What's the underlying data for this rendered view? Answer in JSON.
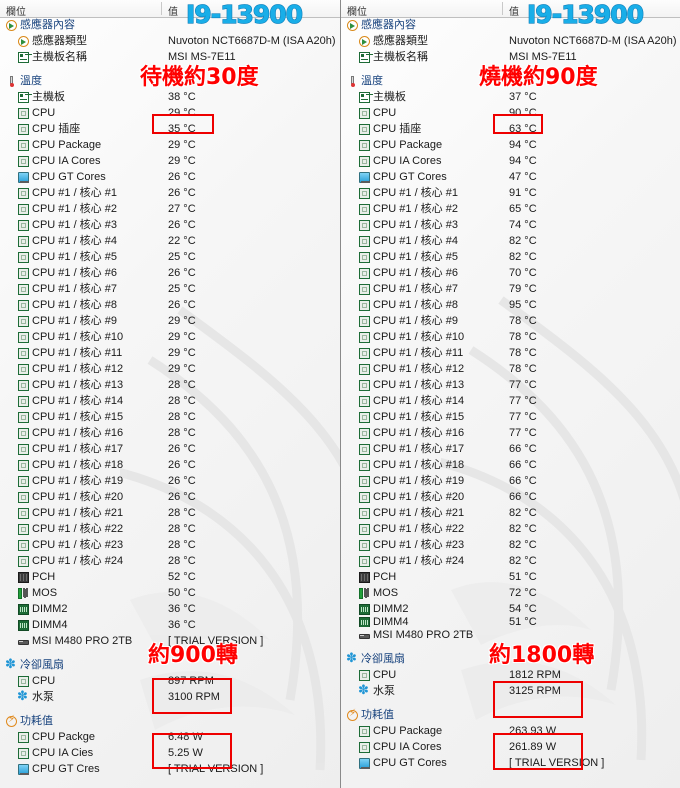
{
  "app": {
    "name": "HWiNFO64 Sensor Status",
    "columns": {
      "field": "欄位",
      "value": "值"
    }
  },
  "annotations": {
    "cpu_model": "I9-13900",
    "left_temp_note": "待機約30度",
    "right_temp_note": "燒機約90度",
    "left_fan_note": "約900轉",
    "right_fan_note": "約1800轉",
    "colors": {
      "red": "#ff0000",
      "blue": "#19aee8",
      "box": "#ee0000"
    }
  },
  "panels": [
    {
      "id": "idle",
      "sections": [
        {
          "name": "感應器內容",
          "icon": "sensor-icon",
          "rows": [
            {
              "label": "感應器類型",
              "value": "Nuvoton NCT6687D-M  (ISA A20h)",
              "icon": "sensor-icon",
              "indent": 2
            },
            {
              "label": "主機板名稱",
              "value": "MSI MS-7E11",
              "icon": "motherboard-icon",
              "indent": 2
            }
          ]
        },
        {
          "name": "溫度",
          "icon": "thermometer-icon",
          "rows": [
            {
              "label": "主機板",
              "value": "38 °C",
              "icon": "motherboard-icon",
              "indent": 2
            },
            {
              "label": "CPU",
              "value": "29 °C",
              "icon": "cpu-icon",
              "indent": 2
            },
            {
              "label": "CPU 插座",
              "value": "35 °C",
              "icon": "cpu-icon",
              "indent": 2
            },
            {
              "label": "CPU Package",
              "value": "29 °C",
              "icon": "cpu-icon",
              "indent": 2
            },
            {
              "label": "CPU IA Cores",
              "value": "29 °C",
              "icon": "cpu-icon",
              "indent": 2
            },
            {
              "label": "CPU GT Cores",
              "value": "26 °C",
              "icon": "gpu-icon",
              "indent": 2
            },
            {
              "label": "CPU #1 / 核心 #1",
              "value": "26 °C",
              "icon": "cpu-icon",
              "indent": 2
            },
            {
              "label": "CPU #1 / 核心 #2",
              "value": "27 °C",
              "icon": "cpu-icon",
              "indent": 2
            },
            {
              "label": "CPU #1 / 核心 #3",
              "value": "26 °C",
              "icon": "cpu-icon",
              "indent": 2
            },
            {
              "label": "CPU #1 / 核心 #4",
              "value": "22 °C",
              "icon": "cpu-icon",
              "indent": 2
            },
            {
              "label": "CPU #1 / 核心 #5",
              "value": "25 °C",
              "icon": "cpu-icon",
              "indent": 2
            },
            {
              "label": "CPU #1 / 核心 #6",
              "value": "26 °C",
              "icon": "cpu-icon",
              "indent": 2
            },
            {
              "label": "CPU #1 / 核心 #7",
              "value": "25 °C",
              "icon": "cpu-icon",
              "indent": 2
            },
            {
              "label": "CPU #1 / 核心 #8",
              "value": "26 °C",
              "icon": "cpu-icon",
              "indent": 2
            },
            {
              "label": "CPU #1 / 核心 #9",
              "value": "29 °C",
              "icon": "cpu-icon",
              "indent": 2
            },
            {
              "label": "CPU #1 / 核心 #10",
              "value": "29 °C",
              "icon": "cpu-icon",
              "indent": 2
            },
            {
              "label": "CPU #1 / 核心 #11",
              "value": "29 °C",
              "icon": "cpu-icon",
              "indent": 2
            },
            {
              "label": "CPU #1 / 核心 #12",
              "value": "29 °C",
              "icon": "cpu-icon",
              "indent": 2
            },
            {
              "label": "CPU #1 / 核心 #13",
              "value": "28 °C",
              "icon": "cpu-icon",
              "indent": 2
            },
            {
              "label": "CPU #1 / 核心 #14",
              "value": "28 °C",
              "icon": "cpu-icon",
              "indent": 2
            },
            {
              "label": "CPU #1 / 核心 #15",
              "value": "28 °C",
              "icon": "cpu-icon",
              "indent": 2
            },
            {
              "label": "CPU #1 / 核心 #16",
              "value": "28 °C",
              "icon": "cpu-icon",
              "indent": 2
            },
            {
              "label": "CPU #1 / 核心 #17",
              "value": "26 °C",
              "icon": "cpu-icon",
              "indent": 2
            },
            {
              "label": "CPU #1 / 核心 #18",
              "value": "26 °C",
              "icon": "cpu-icon",
              "indent": 2
            },
            {
              "label": "CPU #1 / 核心 #19",
              "value": "26 °C",
              "icon": "cpu-icon",
              "indent": 2
            },
            {
              "label": "CPU #1 / 核心 #20",
              "value": "26 °C",
              "icon": "cpu-icon",
              "indent": 2
            },
            {
              "label": "CPU #1 / 核心 #21",
              "value": "28 °C",
              "icon": "cpu-icon",
              "indent": 2
            },
            {
              "label": "CPU #1 / 核心 #22",
              "value": "28 °C",
              "icon": "cpu-icon",
              "indent": 2
            },
            {
              "label": "CPU #1 / 核心 #23",
              "value": "28 °C",
              "icon": "cpu-icon",
              "indent": 2
            },
            {
              "label": "CPU #1 / 核心 #24",
              "value": "28 °C",
              "icon": "cpu-icon",
              "indent": 2
            },
            {
              "label": "PCH",
              "value": "52 °C",
              "icon": "chipset-icon",
              "indent": 2
            },
            {
              "label": "MOS",
              "value": "50 °C",
              "icon": "vrm-icon",
              "indent": 2
            },
            {
              "label": "DIMM2",
              "value": "36 °C",
              "icon": "memory-icon",
              "indent": 2
            },
            {
              "label": "DIMM4",
              "value": "36 °C",
              "icon": "memory-icon",
              "indent": 2
            },
            {
              "label": "MSI M480 PRO 2TB",
              "value": "[ TRIAL VERSION ]",
              "icon": "ssd-icon",
              "indent": 2
            }
          ]
        },
        {
          "name": "冷卻風扇",
          "icon": "fan-icon",
          "rows": [
            {
              "label": "CPU",
              "value": "897 RPM",
              "icon": "cpu-icon",
              "indent": 2
            },
            {
              "label": "水泵",
              "value": "3100 RPM",
              "icon": "pump-icon",
              "indent": 2
            }
          ]
        },
        {
          "name": "功耗值",
          "icon": "power-icon",
          "rows": [
            {
              "label": "CPU Packge",
              "value": "6.48 W",
              "icon": "cpu-icon",
              "indent": 2
            },
            {
              "label": "CPU IA Cies",
              "value": "5.25 W",
              "icon": "cpu-icon",
              "indent": 2
            },
            {
              "label": "CPU GT Cres",
              "value": "[ TRIAL VERSION ]",
              "icon": "gpu-icon",
              "indent": 2
            }
          ]
        }
      ]
    },
    {
      "id": "load",
      "sections": [
        {
          "name": "感應器內容",
          "icon": "sensor-icon",
          "rows": [
            {
              "label": "感應器類型",
              "value": "Nuvoton NCT6687D-M  (ISA A20h)",
              "icon": "sensor-icon",
              "indent": 2
            },
            {
              "label": "主機板名稱",
              "value": "MSI MS-7E11",
              "icon": "motherboard-icon",
              "indent": 2
            }
          ]
        },
        {
          "name": "溫度",
          "icon": "thermometer-icon",
          "rows": [
            {
              "label": "主機板",
              "value": "37 °C",
              "icon": "motherboard-icon",
              "indent": 2
            },
            {
              "label": "CPU",
              "value": "90 °C",
              "icon": "cpu-icon",
              "indent": 2
            },
            {
              "label": "CPU 插座",
              "value": "63 °C",
              "icon": "cpu-icon",
              "indent": 2
            },
            {
              "label": "CPU Package",
              "value": "94 °C",
              "icon": "cpu-icon",
              "indent": 2
            },
            {
              "label": "CPU IA Cores",
              "value": "94 °C",
              "icon": "cpu-icon",
              "indent": 2
            },
            {
              "label": "CPU GT Cores",
              "value": "47 °C",
              "icon": "gpu-icon",
              "indent": 2
            },
            {
              "label": "CPU #1 / 核心 #1",
              "value": "91 °C",
              "icon": "cpu-icon",
              "indent": 2
            },
            {
              "label": "CPU #1 / 核心 #2",
              "value": "65 °C",
              "icon": "cpu-icon",
              "indent": 2
            },
            {
              "label": "CPU #1 / 核心 #3",
              "value": "74 °C",
              "icon": "cpu-icon",
              "indent": 2
            },
            {
              "label": "CPU #1 / 核心 #4",
              "value": "82 °C",
              "icon": "cpu-icon",
              "indent": 2
            },
            {
              "label": "CPU #1 / 核心 #5",
              "value": "82 °C",
              "icon": "cpu-icon",
              "indent": 2
            },
            {
              "label": "CPU #1 / 核心 #6",
              "value": "70 °C",
              "icon": "cpu-icon",
              "indent": 2
            },
            {
              "label": "CPU #1 / 核心 #7",
              "value": "79 °C",
              "icon": "cpu-icon",
              "indent": 2
            },
            {
              "label": "CPU #1 / 核心 #8",
              "value": "95 °C",
              "icon": "cpu-icon",
              "indent": 2
            },
            {
              "label": "CPU #1 / 核心 #9",
              "value": "78 °C",
              "icon": "cpu-icon",
              "indent": 2
            },
            {
              "label": "CPU #1 / 核心 #10",
              "value": "78 °C",
              "icon": "cpu-icon",
              "indent": 2
            },
            {
              "label": "CPU #1 / 核心 #11",
              "value": "78 °C",
              "icon": "cpu-icon",
              "indent": 2
            },
            {
              "label": "CPU #1 / 核心 #12",
              "value": "78 °C",
              "icon": "cpu-icon",
              "indent": 2
            },
            {
              "label": "CPU #1 / 核心 #13",
              "value": "77 °C",
              "icon": "cpu-icon",
              "indent": 2
            },
            {
              "label": "CPU #1 / 核心 #14",
              "value": "77 °C",
              "icon": "cpu-icon",
              "indent": 2
            },
            {
              "label": "CPU #1 / 核心 #15",
              "value": "77 °C",
              "icon": "cpu-icon",
              "indent": 2
            },
            {
              "label": "CPU #1 / 核心 #16",
              "value": "77 °C",
              "icon": "cpu-icon",
              "indent": 2
            },
            {
              "label": "CPU #1 / 核心 #17",
              "value": "66 °C",
              "icon": "cpu-icon",
              "indent": 2
            },
            {
              "label": "CPU #1 / 核心 #18",
              "value": "66 °C",
              "icon": "cpu-icon",
              "indent": 2
            },
            {
              "label": "CPU #1 / 核心 #19",
              "value": "66 °C",
              "icon": "cpu-icon",
              "indent": 2
            },
            {
              "label": "CPU #1 / 核心 #20",
              "value": "66 °C",
              "icon": "cpu-icon",
              "indent": 2
            },
            {
              "label": "CPU #1 / 核心 #21",
              "value": "82 °C",
              "icon": "cpu-icon",
              "indent": 2
            },
            {
              "label": "CPU #1 / 核心 #22",
              "value": "82 °C",
              "icon": "cpu-icon",
              "indent": 2
            },
            {
              "label": "CPU #1 / 核心 #23",
              "value": "82 °C",
              "icon": "cpu-icon",
              "indent": 2
            },
            {
              "label": "CPU #1 / 核心 #24",
              "value": "82 °C",
              "icon": "cpu-icon",
              "indent": 2
            },
            {
              "label": "PCH",
              "value": "51 °C",
              "icon": "chipset-icon",
              "indent": 2
            },
            {
              "label": "MOS",
              "value": "72 °C",
              "icon": "vrm-icon",
              "indent": 2
            },
            {
              "label": "DIMM2",
              "value": "54 °C",
              "icon": "memory-icon",
              "indent": 2
            },
            {
              "label": "DIMM4",
              "value": "51 °C",
              "icon": "memory-icon",
              "indent": 2,
              "clipped": true
            },
            {
              "label": "MSI M480 PRO 2TB",
              "value": "",
              "icon": "ssd-icon",
              "indent": 2
            }
          ]
        },
        {
          "name": "冷卻風扇",
          "icon": "fan-icon",
          "rows": [
            {
              "label": "CPU",
              "value": "1812 RPM",
              "icon": "cpu-icon",
              "indent": 2
            },
            {
              "label": "水泵",
              "value": "3125 RPM",
              "icon": "pump-icon",
              "indent": 2
            }
          ]
        },
        {
          "name": "功耗值",
          "icon": "power-icon",
          "rows": [
            {
              "label": "CPU Package",
              "value": "263.93 W",
              "icon": "cpu-icon",
              "indent": 2
            },
            {
              "label": "CPU IA Cores",
              "value": "261.89 W",
              "icon": "cpu-icon",
              "indent": 2
            },
            {
              "label": "CPU GT Cores",
              "value": "[ TRIAL VERSION ]",
              "icon": "gpu-icon",
              "indent": 2
            }
          ]
        }
      ]
    }
  ]
}
